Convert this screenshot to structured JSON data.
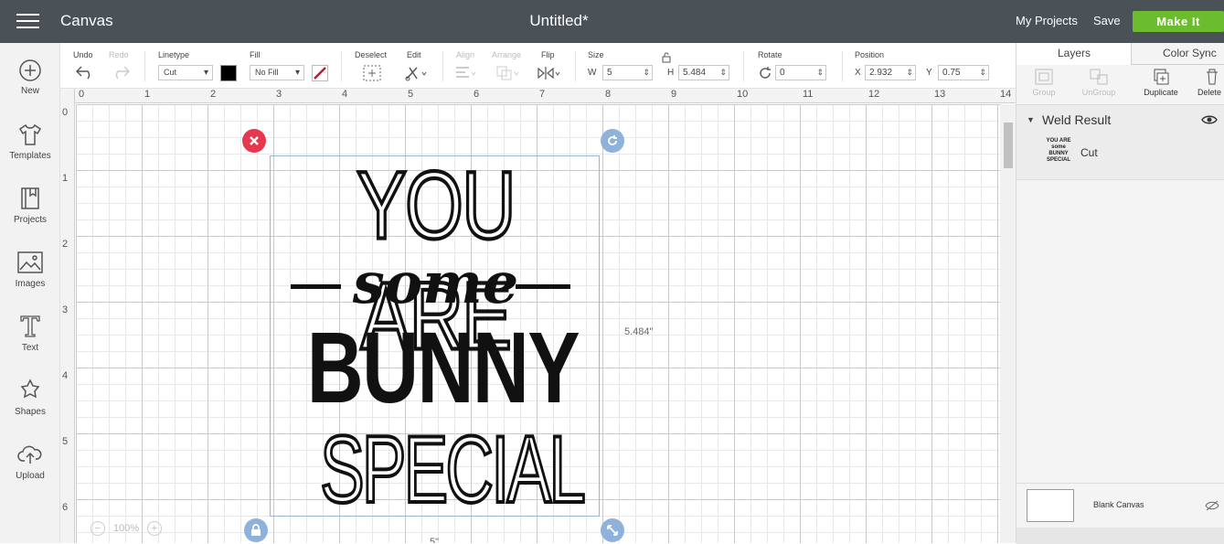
{
  "topbar": {
    "app_title": "Canvas",
    "doc_title": "Untitled*",
    "my_projects": "My Projects",
    "save": "Save",
    "make_it": "Make It"
  },
  "sidebar": {
    "items": [
      {
        "label": "New",
        "icon": "plus-circle-icon"
      },
      {
        "label": "Templates",
        "icon": "tshirt-icon"
      },
      {
        "label": "Projects",
        "icon": "bookmark-book-icon"
      },
      {
        "label": "Images",
        "icon": "image-icon"
      },
      {
        "label": "Text",
        "icon": "text-t-icon"
      },
      {
        "label": "Shapes",
        "icon": "shapes-icon"
      },
      {
        "label": "Upload",
        "icon": "cloud-upload-icon"
      }
    ]
  },
  "toolbar": {
    "undo": "Undo",
    "redo": "Redo",
    "linetype_label": "Linetype",
    "linetype_value": "Cut",
    "fill_label": "Fill",
    "fill_value": "No Fill",
    "deselect": "Deselect",
    "edit": "Edit",
    "align": "Align",
    "arrange": "Arrange",
    "flip": "Flip",
    "size_label": "Size",
    "w_label": "W",
    "w_value": "5",
    "h_label": "H",
    "h_value": "5.484",
    "rotate_label": "Rotate",
    "rotate_value": "0",
    "position_label": "Position",
    "x_label": "X",
    "x_value": "2.932",
    "y_label": "Y",
    "y_value": "0.75",
    "linetype_color": "#000000",
    "fill_color": "#b0203a"
  },
  "canvas": {
    "ruler_top": [
      "0",
      "1",
      "2",
      "3",
      "4",
      "5",
      "6",
      "7",
      "8",
      "9",
      "10",
      "11",
      "12",
      "13",
      "14"
    ],
    "ruler_left": [
      "0",
      "1",
      "2",
      "3",
      "4",
      "5",
      "6"
    ],
    "design_lines": [
      "YOU ARE",
      "some",
      "BUNNY",
      "SPECIAL"
    ],
    "height_dim": "5.484\"",
    "width_dim": "5\"",
    "zoom": "100%"
  },
  "right_panel": {
    "tabs": [
      "Layers",
      "Color Sync"
    ],
    "actions": [
      "Group",
      "UnGroup",
      "Duplicate",
      "Delete"
    ],
    "layer_group": "Weld Result",
    "layer_item": "Cut",
    "blank_canvas": "Blank Canvas"
  }
}
